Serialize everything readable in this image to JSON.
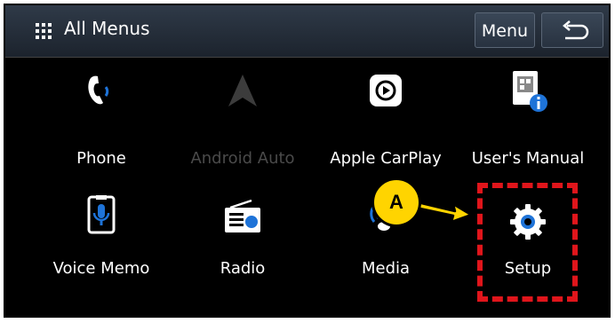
{
  "header": {
    "title": "All Menus",
    "menu_label": "Menu"
  },
  "items": [
    {
      "label": "Phone",
      "icon": "phone-icon",
      "enabled": true
    },
    {
      "label": "Android Auto",
      "icon": "android-auto-icon",
      "enabled": false
    },
    {
      "label": "Apple CarPlay",
      "icon": "carplay-icon",
      "enabled": true
    },
    {
      "label": "User's Manual",
      "icon": "manual-icon",
      "enabled": true
    },
    {
      "label": "Voice Memo",
      "icon": "voice-memo-icon",
      "enabled": true
    },
    {
      "label": "Radio",
      "icon": "radio-icon",
      "enabled": true
    },
    {
      "label": "Media",
      "icon": "media-icon",
      "enabled": true
    },
    {
      "label": "Setup",
      "icon": "gear-icon",
      "enabled": true
    }
  ],
  "annotation": {
    "callout_label": "A",
    "highlight_color": "#e0151b",
    "callout_color": "#ffd400"
  },
  "colors": {
    "accent_blue": "#1e73d8"
  }
}
